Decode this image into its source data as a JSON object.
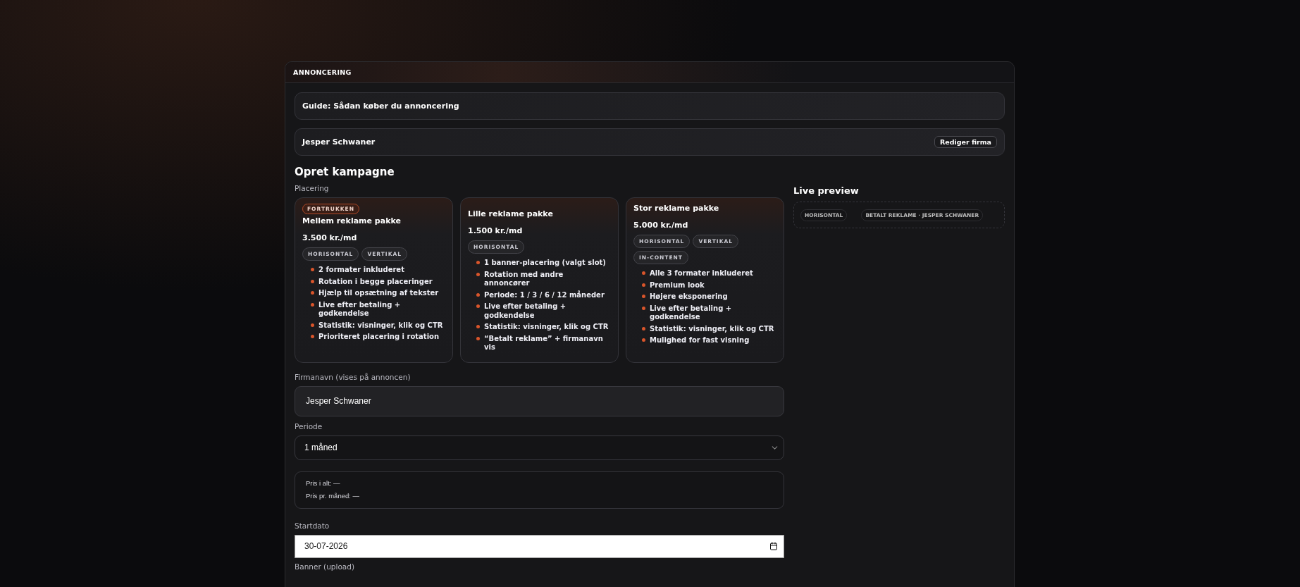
{
  "panel": {
    "title": "ANNONCERING"
  },
  "guide": {
    "label": "Guide: Sådan køber du annoncering"
  },
  "company": {
    "name": "Jesper Schwaner",
    "edit_button": "Rediger firma"
  },
  "heading": "Opret kampagne",
  "placement_label": "Placering",
  "packages": [
    {
      "badge": "FORTRUKKEN",
      "name": "Mellem reklame pakke",
      "price": "3.500 kr./md",
      "formats": [
        "HORISONTAL",
        "VERTIKAL"
      ],
      "features": [
        "2 formater inkluderet",
        "Rotation i begge placeringer",
        "Hjælp til opsætning af tekster",
        "Live efter betaling + godkendelse",
        "Statistik: visninger, klik og CTR",
        "Prioriteret placering i rotation"
      ]
    },
    {
      "name": "Lille reklame pakke",
      "price": "1.500 kr./md",
      "formats": [
        "HORISONTAL"
      ],
      "features": [
        "1 banner-placering (valgt slot)",
        "Rotation med andre annoncører",
        "Periode: 1 / 3 / 6 / 12 måneder",
        "Live efter betaling + godkendelse",
        "Statistik: visninger, klik og CTR",
        "“Betalt reklame” + firmanavn vis"
      ]
    },
    {
      "name": "Stor reklame pakke",
      "price": "5.000 kr./md",
      "formats": [
        "HORISONTAL",
        "VERTIKAL",
        "IN-CONTENT"
      ],
      "features": [
        "Alle 3 formater inkluderet",
        "Premium look",
        "Højere eksponering",
        "Live efter betaling + godkendelse",
        "Statistik: visninger, klik og CTR",
        "Mulighed for fast visning"
      ]
    }
  ],
  "form": {
    "company_label": "Firmanavn (vises på annoncen)",
    "company_value": "Jesper Schwaner",
    "period_label": "Periode",
    "period_value": "1 måned",
    "price_total": "Pris i alt: —",
    "price_month": "Pris pr. måned: —",
    "start_label": "Startdato",
    "start_value": "30-07-2026",
    "banner_label": "Banner (upload)"
  },
  "preview": {
    "title": "Live preview",
    "chips": [
      "HORISONTAL",
      "BETALT REKLAME · JESPER SCHWANER"
    ]
  }
}
